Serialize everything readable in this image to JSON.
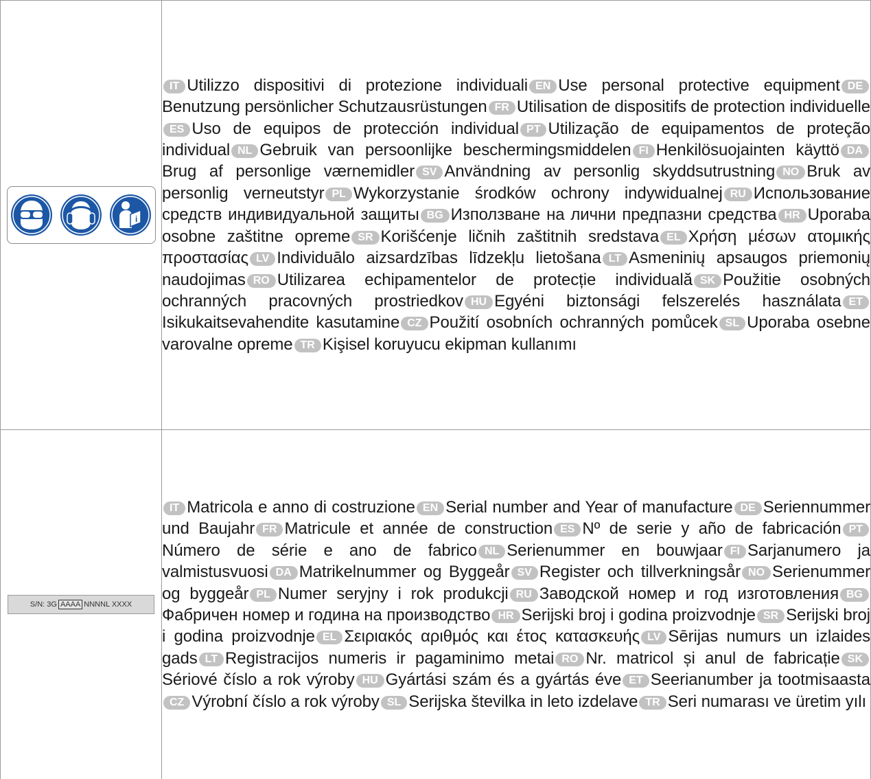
{
  "ppe": {
    "icons": [
      "safety-goggles-icon",
      "ear-protection-icon",
      "read-manual-icon"
    ],
    "color": "#1c57a5",
    "entries": [
      {
        "code": "IT",
        "text": "Utilizzo dispositivi di protezione individuali"
      },
      {
        "code": "EN",
        "text": "Use personal protective equipment"
      },
      {
        "code": "DE",
        "text": "Benutzung persönlicher Schutzausrüstungen"
      },
      {
        "code": "FR",
        "text": "Utilisation de dispositifs de protection individuelle"
      },
      {
        "code": "ES",
        "text": "Uso de equipos de protección individual"
      },
      {
        "code": "PT",
        "text": "Utilização de equipamentos de proteção individual"
      },
      {
        "code": "NL",
        "text": "Gebruik van persoonlijke beschermingsmiddelen"
      },
      {
        "code": "FI",
        "text": "Henkilösuojainten käyttö"
      },
      {
        "code": "DA",
        "text": "Brug af personlige værnemidler"
      },
      {
        "code": "SV",
        "text": "Användning av personlig skyddsutrustning"
      },
      {
        "code": "NO",
        "text": "Bruk av personlig verneutstyr"
      },
      {
        "code": "PL",
        "text": "Wykorzystanie środków ochrony indywidualnej"
      },
      {
        "code": "RU",
        "text": "Использование средств индивидуальной защиты"
      },
      {
        "code": "BG",
        "text": "Използване на лични предпазни средства"
      },
      {
        "code": "HR",
        "text": "Uporaba osobne zaštitne opreme"
      },
      {
        "code": "SR",
        "text": "Korišćenje ličnih zaštitnih sredstava"
      },
      {
        "code": "EL",
        "text": "Χρήση μέσων ατομικής προστασίας"
      },
      {
        "code": "LV",
        "text": "Individuālo aizsardzības līdzekļu lietošana"
      },
      {
        "code": "LT",
        "text": "Asmeninių apsaugos priemonių naudojimas"
      },
      {
        "code": "RO",
        "text": "Utilizarea echipamentelor de protecție individuală"
      },
      {
        "code": "SK",
        "text": "Použitie osobných ochranných pracovných prostriedkov"
      },
      {
        "code": "HU",
        "text": "Egyéni biztonsági felszerelés használata"
      },
      {
        "code": "ET",
        "text": "Isikukaitsevahendite kasutamine"
      },
      {
        "code": "CZ",
        "text": "Použití osobních ochranných pomůcek"
      },
      {
        "code": "SL",
        "text": "Uporaba osebne varovalne opreme"
      },
      {
        "code": "TR",
        "text": "Kişisel koruyucu ekipman kullanımı"
      }
    ]
  },
  "serial": {
    "plate": {
      "prefix": "S/N: 3G",
      "boxed": "AAAA",
      "suffix": "NNNNL XXXX"
    },
    "entries": [
      {
        "code": "IT",
        "text": "Matricola e anno di costruzione"
      },
      {
        "code": "EN",
        "text": "Serial number and Year of manufacture"
      },
      {
        "code": "DE",
        "text": "Seriennummer und Baujahr"
      },
      {
        "code": "FR",
        "text": "Matricule et année de construction"
      },
      {
        "code": "ES",
        "text": "Nº de serie y año de fabricación"
      },
      {
        "code": "PT",
        "text": "Número de série e ano de fabrico"
      },
      {
        "code": "NL",
        "text": "Serienummer en bouwjaar"
      },
      {
        "code": "FI",
        "text": "Sarjanumero ja valmistusvuosi"
      },
      {
        "code": "DA",
        "text": "Matrikelnummer og Byggeår"
      },
      {
        "code": "SV",
        "text": "Register och tillverkningsår"
      },
      {
        "code": "NO",
        "text": "Serienummer og byggeår"
      },
      {
        "code": "PL",
        "text": "Numer seryjny i rok produkcji"
      },
      {
        "code": "RU",
        "text": "Заводской номер и год изготовления"
      },
      {
        "code": "BG",
        "text": "Фабричен номер и година на производство"
      },
      {
        "code": "HR",
        "text": "Serijski broj i godina proizvodnje"
      },
      {
        "code": "SR",
        "text": "Serijski broj i godina proizvodnje"
      },
      {
        "code": "EL",
        "text": "Σειριακός αριθμός και έτος κατασκευής"
      },
      {
        "code": "LV",
        "text": "Sērijas numurs un izlaides gads"
      },
      {
        "code": "LT",
        "text": "Registracijos numeris ir pagaminimo metai"
      },
      {
        "code": "RO",
        "text": "Nr. matricol și anul de fabricație"
      },
      {
        "code": "SK",
        "text": "Sériové číslo a rok výroby"
      },
      {
        "code": "HU",
        "text": "Gyártási szám és a gyártás éve"
      },
      {
        "code": "ET",
        "text": "Seerianumber ja tootmisaasta"
      },
      {
        "code": "CZ",
        "text": "Výrobní číslo a rok výroby"
      },
      {
        "code": "SL",
        "text": "Serijska številka in leto izdelave"
      },
      {
        "code": "TR",
        "text": "Seri numarası ve üretim yılı"
      }
    ]
  }
}
